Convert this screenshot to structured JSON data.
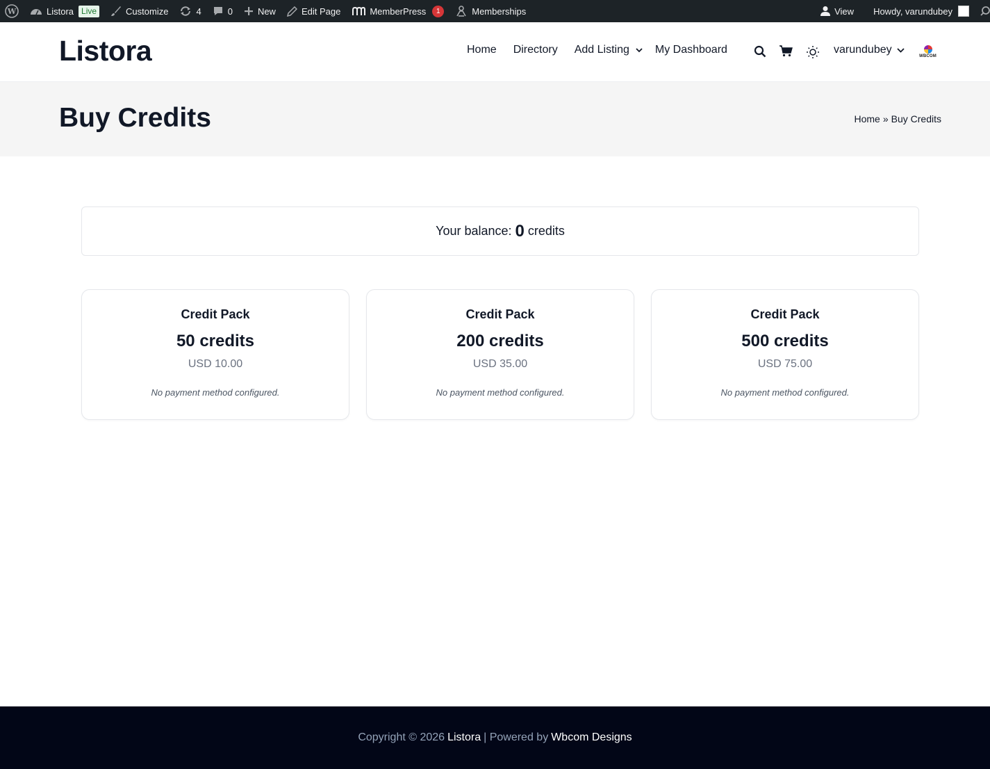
{
  "admin_bar": {
    "site_name": "Listora",
    "live_badge": "Live",
    "customize": "Customize",
    "updates_count": "4",
    "comments_count": "0",
    "new_label": "New",
    "edit_page": "Edit Page",
    "memberpress": "MemberPress",
    "memberpress_badge": "1",
    "memberships": "Memberships",
    "view": "View",
    "howdy": "Howdy, varundubey"
  },
  "header": {
    "logo": "Listora",
    "nav": [
      {
        "label": "Home"
      },
      {
        "label": "Directory"
      },
      {
        "label": "Add Listing"
      },
      {
        "label": "My Dashboard"
      }
    ],
    "user": "varundubey",
    "brand_logo_text": "WBCOM"
  },
  "title_band": {
    "title": "Buy Credits",
    "breadcrumb": {
      "home": "Home",
      "sep": "»",
      "current": "Buy Credits"
    }
  },
  "balance": {
    "prefix": "Your balance:",
    "value": "0",
    "suffix": "credits"
  },
  "packs": [
    {
      "title": "Credit Pack",
      "credits": "50 credits",
      "price": "USD 10.00",
      "note": "No payment method configured."
    },
    {
      "title": "Credit Pack",
      "credits": "200 credits",
      "price": "USD 35.00",
      "note": "No payment method configured."
    },
    {
      "title": "Credit Pack",
      "credits": "500 credits",
      "price": "USD 75.00",
      "note": "No payment method configured."
    }
  ],
  "footer": {
    "copyright": "Copyright © 2026",
    "site_link": "Listora",
    "powered": "| Powered by",
    "vendor_link": "Wbcom Designs"
  },
  "colors": {
    "admin_bar_bg": "#1d2327",
    "footer_bg": "#020617",
    "title_band_bg": "#f5f5f5",
    "badge_red": "#d63638"
  }
}
